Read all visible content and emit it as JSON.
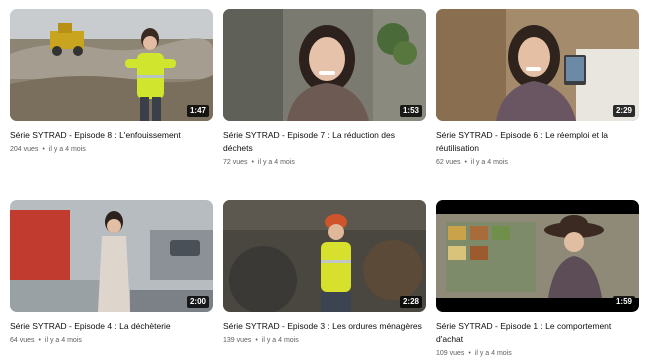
{
  "videos": [
    {
      "title": "Série SYTRAD - Episode 8 : L'enfouissement",
      "views": "204 vues",
      "age": "il y a 4 mois",
      "duration": "1:47"
    },
    {
      "title": "Série SYTRAD - Episode 7 : La réduction des déchets",
      "views": "72 vues",
      "age": "il y a 4 mois",
      "duration": "1:53"
    },
    {
      "title": "Série SYTRAD - Episode 6 : Le réemploi et la réutilisation",
      "views": "62 vues",
      "age": "il y a 4 mois",
      "duration": "2:29"
    },
    {
      "title": "Série SYTRAD - Episode 4 : La déchèterie",
      "views": "64 vues",
      "age": "il y a 4 mois",
      "duration": "2:00"
    },
    {
      "title": "Série SYTRAD - Episode 3 : Les ordures ménagères",
      "views": "139 vues",
      "age": "il y a 4 mois",
      "duration": "2:28"
    },
    {
      "title": "Série SYTRAD - Episode 1 : Le comportement d'achat",
      "views": "109 vues",
      "age": "il y a 4 mois",
      "duration": "1:59"
    }
  ],
  "meta_separator": "•"
}
